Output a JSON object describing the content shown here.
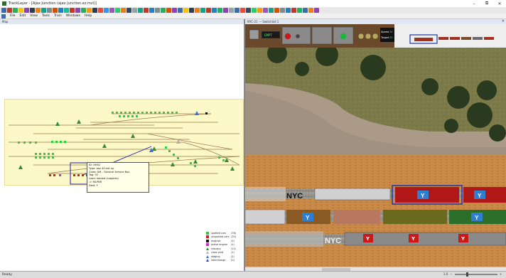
{
  "window": {
    "title": "TrackLayer - [Ajax Junction (ajax junction.ez.mzl)]",
    "minimize": "–",
    "maximize": "⧉",
    "close": "✕"
  },
  "menu": {
    "items": [
      "File",
      "Edit",
      "View",
      "Tools",
      "Train",
      "Windows",
      "Help"
    ]
  },
  "left_pane": {
    "header": "Map"
  },
  "right_pane": {
    "header": "NYC-21 --- Switchlist 1",
    "header_close": "✕"
  },
  "tooltip": {
    "lines": [
      "ID: XM52",
      "Type: box 40 ext up",
      "Class: XM - General Service Box",
      "Tag: 32",
      "Load: loaded (supplies)",
      "-> RILPBR",
      "Dest: Y"
    ]
  },
  "legend": [
    {
      "label": "spotted cars",
      "count": "(78)",
      "color": "#2ecc40",
      "shape": "square"
    },
    {
      "label": "unspotted cars",
      "count": "(20)",
      "color": "#e01818",
      "shape": "square"
    },
    {
      "label": "engines",
      "count": "(2)",
      "color": "#111111",
      "shape": "square"
    },
    {
      "label": "active engine",
      "count": "(1)",
      "color": "#e020e0",
      "shape": "square"
    },
    {
      "label": "industry",
      "count": "(11)",
      "color": "#2e8b3a",
      "shape": "triangle"
    },
    {
      "label": "class yard",
      "count": "(1)",
      "color": "#b0b0b0",
      "shape": "triangle"
    },
    {
      "label": "staging",
      "count": "(2)",
      "color": "#3a6ee0",
      "shape": "triangle"
    },
    {
      "label": "interchange",
      "count": "(0)",
      "color": "#3a3ae0",
      "shape": "triangle"
    }
  ],
  "hud": {
    "speed_label": "Speed",
    "speed_value": "24",
    "target_label": "Target",
    "target_value": "20",
    "mini_digital": "EMPT"
  },
  "car_marks": {
    "reporting_1": "NYC",
    "reporting_2": "NYC",
    "y_letter": "Y"
  },
  "status": {
    "text": "Ready",
    "zoom_minus": "−",
    "zoom_plus": "+",
    "zoom_value": "1.0"
  },
  "colors": {
    "accent": "#2e5c9a",
    "track": "#8a6a40",
    "selection": "#1a1aaa"
  }
}
